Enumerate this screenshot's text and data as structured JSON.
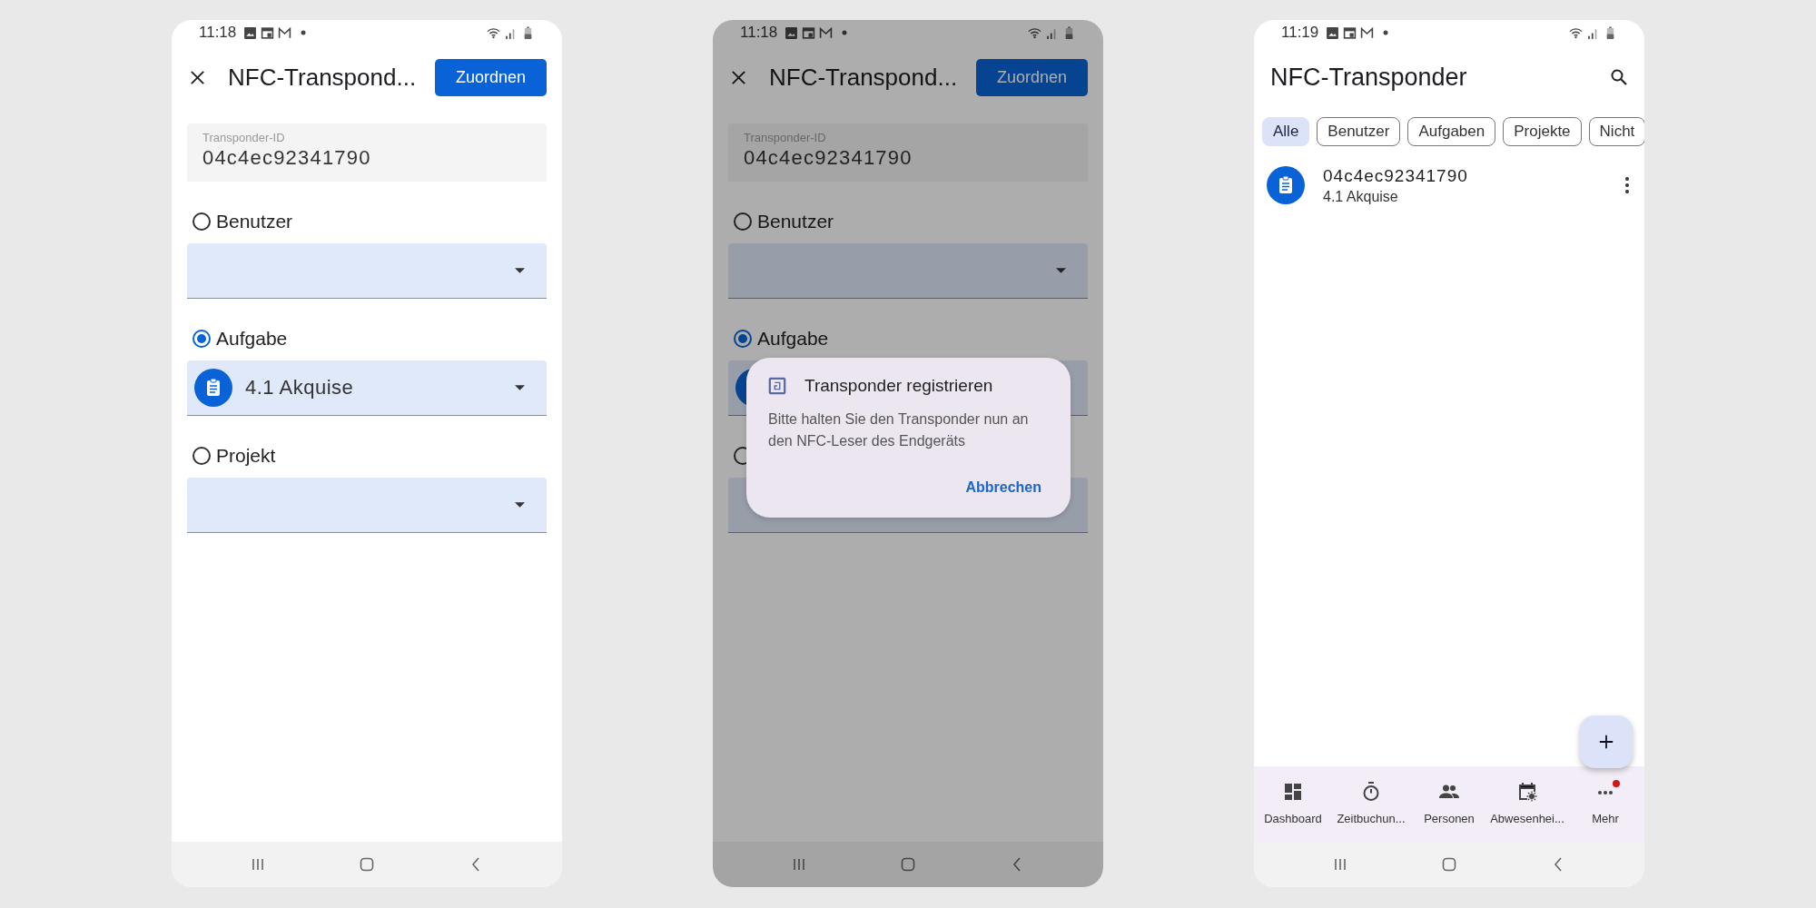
{
  "screens": [
    {
      "kind": "form",
      "status_time": "11:18",
      "dimmed": false,
      "title": "NFC-Transpond...",
      "action": "Zuordnen",
      "id_field": {
        "label": "Transponder-ID",
        "value": "04c4ec92341790"
      },
      "options": [
        {
          "label": "Benutzer",
          "selected": false
        },
        {
          "label": "Aufgabe",
          "selected": true,
          "icon": true,
          "value": "4.1 Akquise"
        },
        {
          "label": "Projekt",
          "selected": false
        }
      ]
    },
    {
      "kind": "form",
      "status_time": "11:18",
      "dimmed": true,
      "title": "NFC-Transpond...",
      "action": "Zuordnen",
      "id_field": {
        "label": "Transponder-ID",
        "value": "04c4ec92341790"
      },
      "options": [
        {
          "label": "Benutzer",
          "selected": false
        },
        {
          "label": "Aufgabe",
          "selected": true,
          "icon": true
        },
        {
          "selected": false
        }
      ],
      "dialog": {
        "title": "Transponder registrieren",
        "message": "Bitte halten Sie den Transponder nun an den NFC-Leser des Endgeräts",
        "button": "Abbrechen"
      }
    },
    {
      "kind": "list",
      "status_time": "11:19",
      "title": "NFC-Transponder",
      "chips": [
        {
          "label": "Alle",
          "selected": true
        },
        {
          "label": "Benutzer",
          "selected": false
        },
        {
          "label": "Aufgaben",
          "selected": false
        },
        {
          "label": "Projekte",
          "selected": false
        },
        {
          "label": "Nicht",
          "selected": false
        }
      ],
      "items": [
        {
          "title": "04c4ec92341790",
          "subtitle": "4.1 Akquise"
        }
      ],
      "nav": [
        {
          "label": "Dashboard",
          "kind": "dashboard",
          "badge": false
        },
        {
          "label": "Zeitbuchun...",
          "kind": "timer",
          "badge": false
        },
        {
          "label": "Personen",
          "kind": "people",
          "badge": false
        },
        {
          "label": "Abwesenhei...",
          "kind": "calendar",
          "badge": false
        },
        {
          "label": "Mehr",
          "kind": "more",
          "badge": true
        }
      ]
    }
  ]
}
